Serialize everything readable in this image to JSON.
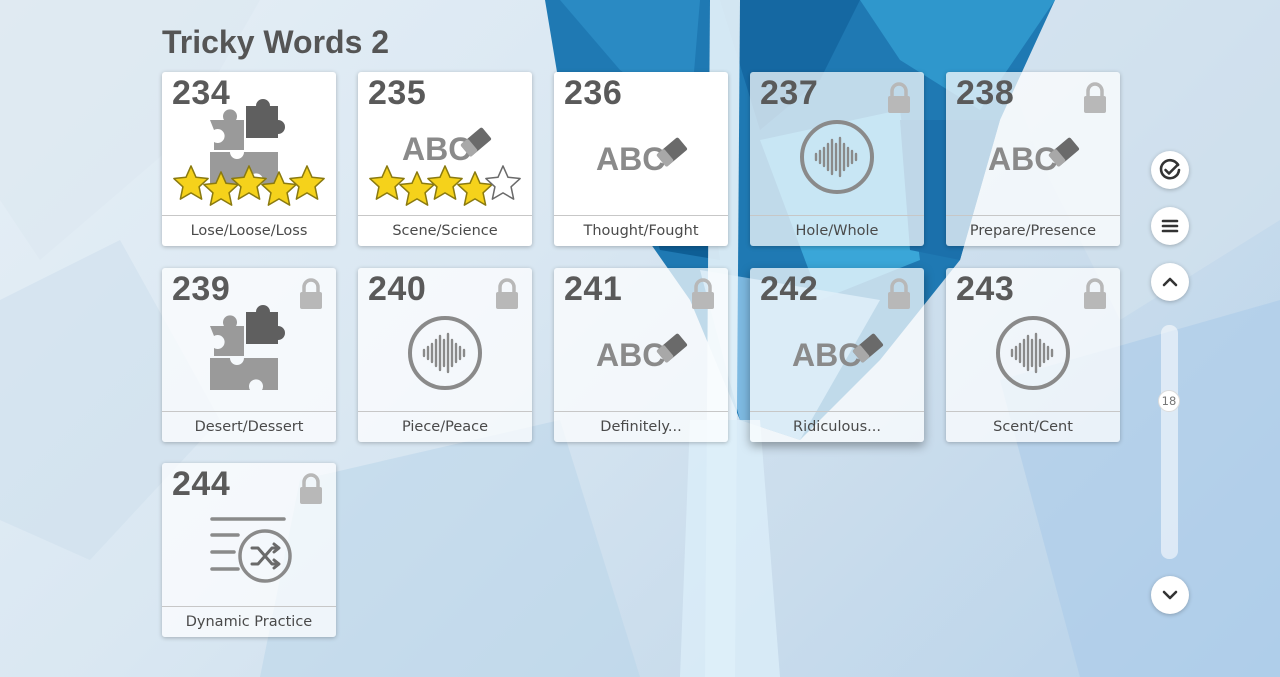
{
  "page": {
    "title": "Tricky Words 2"
  },
  "tiles": [
    {
      "number": "234",
      "label": "Lose/Loose/Loss",
      "icon": "puzzle-icon",
      "locked": false,
      "stars": 5
    },
    {
      "number": "235",
      "label": "Scene/Science",
      "icon": "abc-eraser-icon",
      "locked": false,
      "stars": 4
    },
    {
      "number": "236",
      "label": "Thought/Fought",
      "icon": "abc-eraser-icon",
      "locked": false,
      "stars": 0
    },
    {
      "number": "237",
      "label": "Hole/Whole",
      "icon": "audio-wave-icon",
      "locked": true,
      "stars": 0
    },
    {
      "number": "238",
      "label": "Prepare/Presence",
      "icon": "abc-eraser-icon",
      "locked": true,
      "stars": 0
    },
    {
      "number": "239",
      "label": "Desert/Dessert",
      "icon": "puzzle-icon",
      "locked": true,
      "stars": 0
    },
    {
      "number": "240",
      "label": "Piece/Peace",
      "icon": "audio-wave-icon",
      "locked": true,
      "stars": 0
    },
    {
      "number": "241",
      "label": "Definitely...",
      "icon": "abc-eraser-icon",
      "locked": true,
      "stars": 0
    },
    {
      "number": "242",
      "label": "Ridiculous...",
      "icon": "abc-eraser-icon",
      "locked": true,
      "stars": 0
    },
    {
      "number": "243",
      "label": "Scent/Cent",
      "icon": "audio-wave-icon",
      "locked": true,
      "stars": 0
    },
    {
      "number": "244",
      "label": "Dynamic Practice",
      "icon": "shuffle-list-icon",
      "locked": true,
      "stars": 0
    }
  ],
  "icon_text": {
    "abc": "ABC"
  },
  "sidebar": {
    "buttons": [
      "check-circle-icon",
      "menu-icon",
      "chevron-up-icon",
      "chevron-down-icon"
    ],
    "scroll_value": "18"
  },
  "colors": {
    "star_fill": "#f5d21b",
    "icon_gray": "#8a8a8a",
    "title": "#555555"
  }
}
